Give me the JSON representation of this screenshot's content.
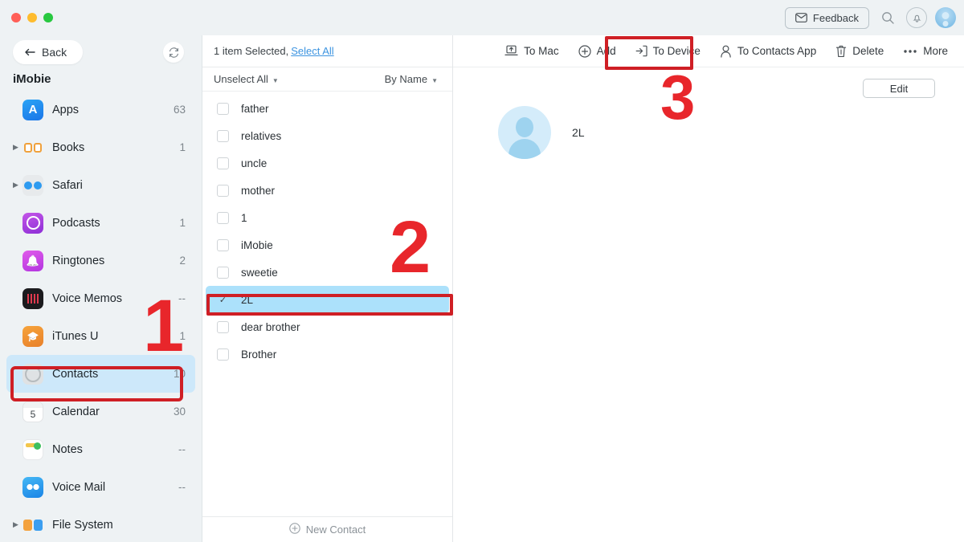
{
  "titlebar": {
    "feedback_label": "Feedback",
    "search_icon": "search-icon",
    "bell_icon": "bell-icon",
    "avatar_icon": "user-avatar"
  },
  "sidebar": {
    "back_label": "Back",
    "refresh_icon": "refresh-icon",
    "device_name": "iMobie",
    "items": [
      {
        "label": "Apps",
        "count": "63",
        "icon": "apps-icon",
        "twisty": false,
        "selected": false
      },
      {
        "label": "Books",
        "count": "1",
        "icon": "books-icon",
        "twisty": true,
        "selected": false
      },
      {
        "label": "Safari",
        "count": "",
        "icon": "safari-icon",
        "twisty": true,
        "selected": false
      },
      {
        "label": "Podcasts",
        "count": "1",
        "icon": "podcasts-icon",
        "twisty": false,
        "selected": false
      },
      {
        "label": "Ringtones",
        "count": "2",
        "icon": "ringtones-icon",
        "twisty": false,
        "selected": false
      },
      {
        "label": "Voice Memos",
        "count": "--",
        "icon": "voice-memos-icon",
        "twisty": false,
        "selected": false
      },
      {
        "label": "iTunes U",
        "count": "1",
        "icon": "itunes-u-icon",
        "twisty": false,
        "selected": false
      },
      {
        "label": "Contacts",
        "count": "10",
        "icon": "contacts-icon",
        "twisty": false,
        "selected": true
      },
      {
        "label": "Calendar",
        "count": "30",
        "icon": "calendar-icon",
        "twisty": false,
        "selected": false
      },
      {
        "label": "Notes",
        "count": "--",
        "icon": "notes-icon",
        "twisty": false,
        "selected": false
      },
      {
        "label": "Voice Mail",
        "count": "--",
        "icon": "voice-mail-icon",
        "twisty": false,
        "selected": false
      },
      {
        "label": "File System",
        "count": "",
        "icon": "file-system-icon",
        "twisty": true,
        "selected": false
      }
    ]
  },
  "list": {
    "selection_text": "1 item Selected,",
    "select_all_link": "Select All",
    "unselect_all_label": "Unselect All",
    "sort_label": "By Name",
    "new_contact_label": "New Contact",
    "rows": [
      {
        "label": "father",
        "checked": false
      },
      {
        "label": "relatives",
        "checked": false
      },
      {
        "label": "uncle",
        "checked": false
      },
      {
        "label": "mother",
        "checked": false
      },
      {
        "label": "1",
        "checked": false
      },
      {
        "label": "iMobie",
        "checked": false
      },
      {
        "label": "sweetie",
        "checked": false
      },
      {
        "label": "2L",
        "checked": true
      },
      {
        "label": "dear brother",
        "checked": false
      },
      {
        "label": "Brother",
        "checked": false
      }
    ]
  },
  "toolbar": {
    "items": [
      {
        "label": "To Mac",
        "icon": "export-to-mac-icon"
      },
      {
        "label": "Add",
        "icon": "plus-circle-icon"
      },
      {
        "label": "To Device",
        "icon": "to-device-icon"
      },
      {
        "label": "To Contacts App",
        "icon": "person-icon"
      },
      {
        "label": "Delete",
        "icon": "trash-icon"
      },
      {
        "label": "More",
        "icon": "ellipsis-icon"
      }
    ]
  },
  "detail": {
    "edit_label": "Edit",
    "contact_name": "2L",
    "avatar_icon": "contact-avatar"
  },
  "annotations": {
    "step1": "1",
    "step2": "2",
    "step3": "3",
    "color": "#e8262b"
  }
}
